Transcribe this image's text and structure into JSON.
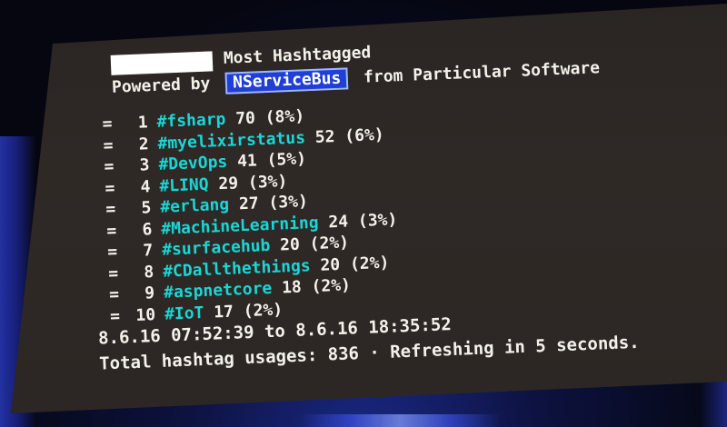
{
  "header": {
    "title": "Most Hashtagged",
    "powered_prefix": "Powered by",
    "product": "NServiceBus",
    "from_text": "from",
    "company": "Particular Software"
  },
  "rankings": [
    {
      "marker": "=",
      "rank": "1",
      "tag": "#fsharp",
      "count": "70",
      "pct": "(8%)"
    },
    {
      "marker": "=",
      "rank": "2",
      "tag": "#myelixirstatus",
      "count": "52",
      "pct": "(6%)"
    },
    {
      "marker": "=",
      "rank": "3",
      "tag": "#DevOps",
      "count": "41",
      "pct": "(5%)"
    },
    {
      "marker": "=",
      "rank": "4",
      "tag": "#LINQ",
      "count": "29",
      "pct": "(3%)"
    },
    {
      "marker": "=",
      "rank": "5",
      "tag": "#erlang",
      "count": "27",
      "pct": "(3%)"
    },
    {
      "marker": "=",
      "rank": "6",
      "tag": "#MachineLearning",
      "count": "24",
      "pct": "(3%)"
    },
    {
      "marker": "=",
      "rank": "7",
      "tag": "#surfacehub",
      "count": "20",
      "pct": "(2%)"
    },
    {
      "marker": "=",
      "rank": "8",
      "tag": "#CDallthethings",
      "count": "20",
      "pct": "(2%)"
    },
    {
      "marker": "=",
      "rank": "9",
      "tag": "#aspnetcore",
      "count": "18",
      "pct": "(2%)"
    },
    {
      "marker": "=",
      "rank": "10",
      "tag": "#IoT",
      "count": "17",
      "pct": "(2%)"
    }
  ],
  "footer": {
    "range": "8.6.16 07:52:39 to 8.6.16 18:35:52",
    "total": "Total hashtag usages: 836 · Refreshing in 5 seconds."
  },
  "colors": {
    "screen_bg": "#2c2624",
    "text": "#f4f1ea",
    "hashtag": "#1ad6d6",
    "badge_bg": "#1f3fd6",
    "stage_blue": "#1b2a8a"
  }
}
